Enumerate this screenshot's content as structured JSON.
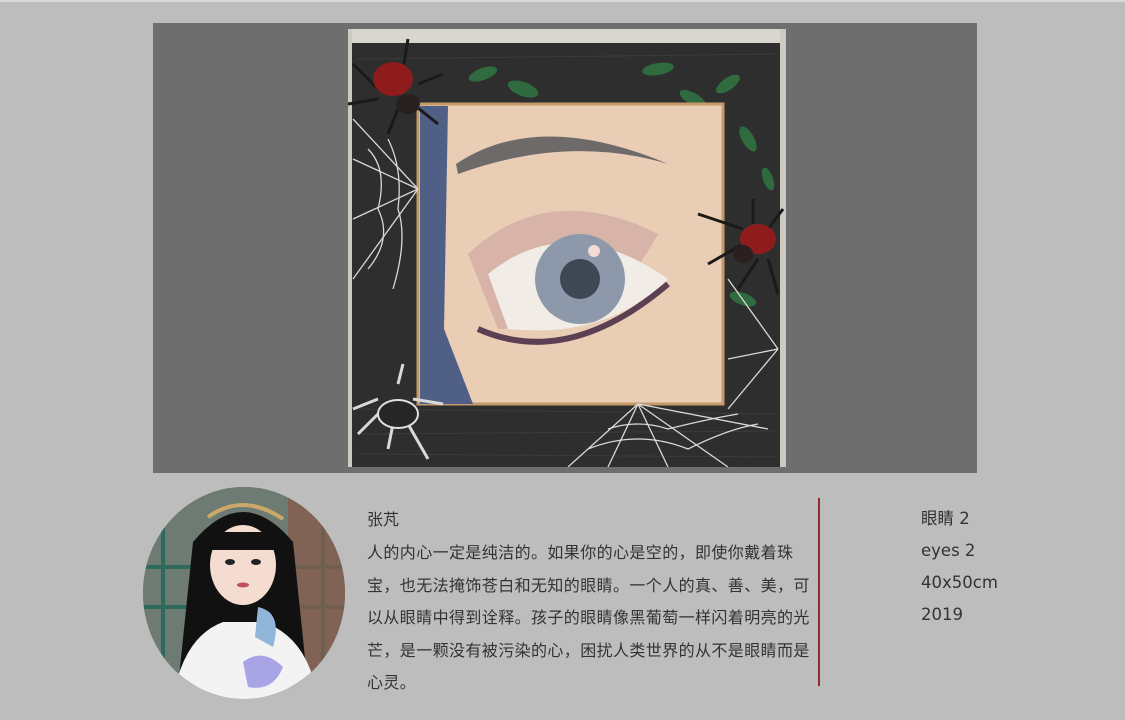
{
  "artwork": {
    "icons": [
      "painting-eye",
      "spider-icon",
      "spiderweb-icon",
      "leaf-icon"
    ]
  },
  "artist": {
    "name": "张芃",
    "statement": "人的内心一定是纯洁的。如果你的心是空的，即使你戴着珠宝，也无法掩饰苍白和无知的眼睛。一个人的真、善、美，可以从眼睛中得到诠释。孩子的眼睛像黑葡萄一样闪着明亮的光芒，是一颗没有被污染的心，困扰人类世界的从不是眼睛而是心灵。"
  },
  "meta": {
    "title_cn": "眼睛 2",
    "title_en": "eyes 2",
    "size": "40x50cm",
    "year": "2019"
  },
  "colors": {
    "page_background": "#bdbdbd",
    "stage_background": "#6e6e6e",
    "divider": "#8e2a33",
    "text": "#333333"
  }
}
